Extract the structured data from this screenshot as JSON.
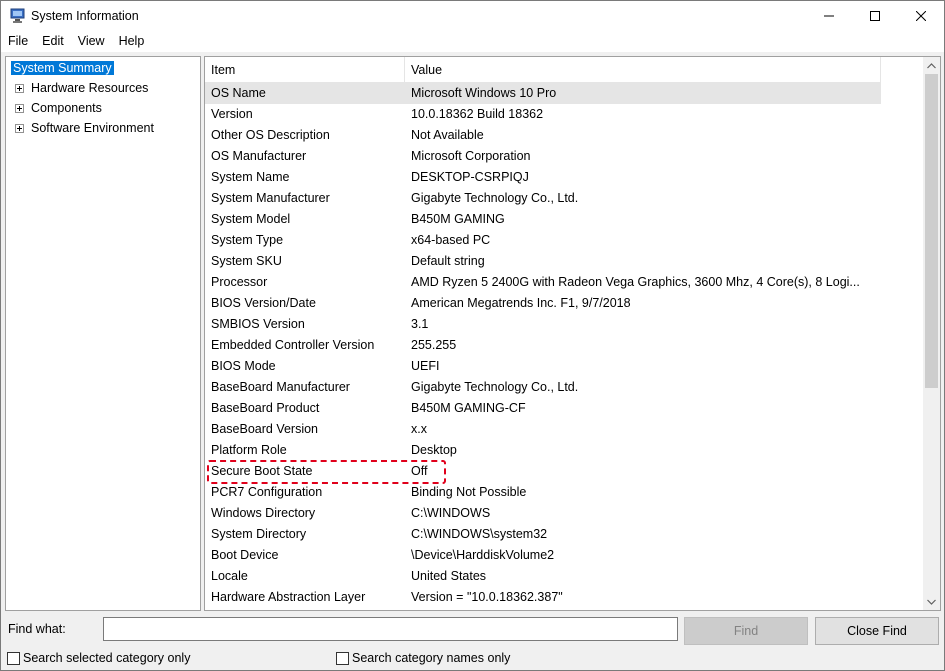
{
  "window": {
    "title": "System Information"
  },
  "menu": [
    "File",
    "Edit",
    "View",
    "Help"
  ],
  "tree": {
    "items": [
      {
        "label": "System Summary",
        "selected": true,
        "expandable": false
      },
      {
        "label": "Hardware Resources",
        "selected": false,
        "expandable": true
      },
      {
        "label": "Components",
        "selected": false,
        "expandable": true
      },
      {
        "label": "Software Environment",
        "selected": false,
        "expandable": true
      }
    ]
  },
  "list": {
    "columns": {
      "item": "Item",
      "value": "Value"
    },
    "rows": [
      {
        "item": "OS Name",
        "value": "Microsoft Windows 10 Pro"
      },
      {
        "item": "Version",
        "value": "10.0.18362 Build 18362"
      },
      {
        "item": "Other OS Description",
        "value": "Not Available"
      },
      {
        "item": "OS Manufacturer",
        "value": "Microsoft Corporation"
      },
      {
        "item": "System Name",
        "value": "DESKTOP-CSRPIQJ"
      },
      {
        "item": "System Manufacturer",
        "value": "Gigabyte Technology Co., Ltd."
      },
      {
        "item": "System Model",
        "value": "B450M GAMING"
      },
      {
        "item": "System Type",
        "value": "x64-based PC"
      },
      {
        "item": "System SKU",
        "value": "Default string"
      },
      {
        "item": "Processor",
        "value": "AMD Ryzen 5 2400G with Radeon Vega Graphics, 3600 Mhz, 4 Core(s), 8 Logi..."
      },
      {
        "item": "BIOS Version/Date",
        "value": "American Megatrends Inc. F1, 9/7/2018"
      },
      {
        "item": "SMBIOS Version",
        "value": "3.1"
      },
      {
        "item": "Embedded Controller Version",
        "value": "255.255"
      },
      {
        "item": "BIOS Mode",
        "value": "UEFI"
      },
      {
        "item": "BaseBoard Manufacturer",
        "value": "Gigabyte Technology Co., Ltd."
      },
      {
        "item": "BaseBoard Product",
        "value": "B450M GAMING-CF"
      },
      {
        "item": "BaseBoard Version",
        "value": "x.x"
      },
      {
        "item": "Platform Role",
        "value": "Desktop"
      },
      {
        "item": "Secure Boot State",
        "value": "Off"
      },
      {
        "item": "PCR7 Configuration",
        "value": "Binding Not Possible"
      },
      {
        "item": "Windows Directory",
        "value": "C:\\WINDOWS"
      },
      {
        "item": "System Directory",
        "value": "C:\\WINDOWS\\system32"
      },
      {
        "item": "Boot Device",
        "value": "\\Device\\HarddiskVolume2"
      },
      {
        "item": "Locale",
        "value": "United States"
      },
      {
        "item": "Hardware Abstraction Layer",
        "value": "Version = \"10.0.18362.387\""
      }
    ],
    "highlight_color": "#e0001b",
    "selected_row_color": "#e5e5e5"
  },
  "find": {
    "label": "Find what:",
    "value": "",
    "find_button": "Find",
    "close_button": "Close Find",
    "search_selected_label": "Search selected category only",
    "search_names_label": "Search category names only"
  },
  "colors": {
    "selection": "#0078d7"
  }
}
